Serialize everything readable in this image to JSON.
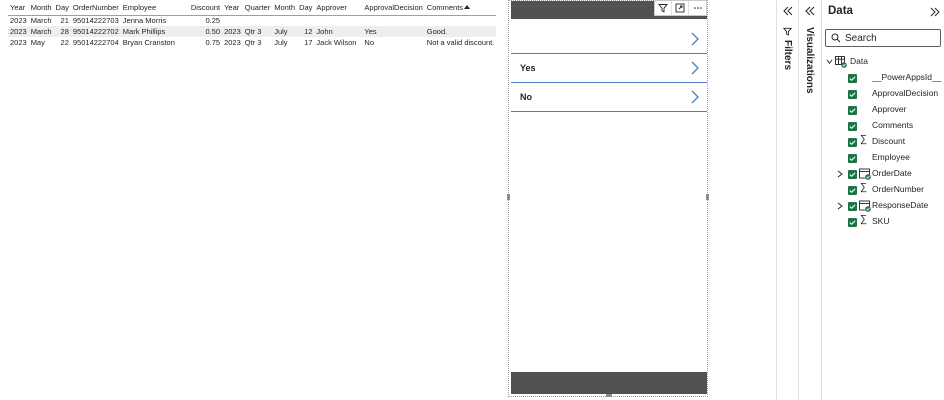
{
  "table": {
    "columns": [
      "Year",
      "Month",
      "Day",
      "OrderNumber",
      "Employee",
      "Discount",
      "Year",
      "Quarter",
      "Month",
      "Day",
      "Approver",
      "ApprovalDecision",
      "Comments"
    ],
    "rows": [
      [
        "2023",
        "March",
        "21",
        "95014222703",
        "Jenna Morris",
        "0.25",
        "",
        "",
        "",
        "",
        "",
        "",
        ""
      ],
      [
        "2023",
        "March",
        "28",
        "95014222702",
        "Mark Phillips",
        "0.50",
        "2023",
        "Qtr 3",
        "July",
        "12",
        "John",
        "Yes",
        "Good."
      ],
      [
        "2023",
        "May",
        "22",
        "95014222704",
        "Bryan Cranston",
        "0.75",
        "2023",
        "Qtr 3",
        "July",
        "17",
        "Jack Wilson",
        "No",
        "Not a valid discount."
      ]
    ]
  },
  "powerapp": {
    "items": [
      {
        "label": ""
      },
      {
        "label": "Yes"
      },
      {
        "label": "No"
      }
    ]
  },
  "panes": {
    "filters_label": "Filters",
    "visualizations_label": "Visualizations",
    "data_title": "Data",
    "search_placeholder": "Search",
    "table_name": "Data",
    "fields": [
      {
        "label": "__PowerAppsId__",
        "type": "text",
        "checked": false,
        "expandable": false
      },
      {
        "label": "ApprovalDecision",
        "type": "text",
        "checked": true,
        "expandable": false
      },
      {
        "label": "Approver",
        "type": "text",
        "checked": true,
        "expandable": false
      },
      {
        "label": "Comments",
        "type": "text",
        "checked": true,
        "expandable": false
      },
      {
        "label": "Discount",
        "type": "sum",
        "checked": true,
        "expandable": false
      },
      {
        "label": "Employee",
        "type": "text",
        "checked": true,
        "expandable": false
      },
      {
        "label": "OrderDate",
        "type": "date",
        "checked": true,
        "expandable": true
      },
      {
        "label": "OrderNumber",
        "type": "sum",
        "checked": true,
        "expandable": false
      },
      {
        "label": "ResponseDate",
        "type": "date",
        "checked": true,
        "expandable": true
      },
      {
        "label": "SKU",
        "type": "sum",
        "checked": true,
        "expandable": false
      }
    ]
  },
  "colors": {
    "accent_green": "#217346",
    "header_gray": "#525252",
    "row_divider_blue": "#4f7dbb"
  }
}
